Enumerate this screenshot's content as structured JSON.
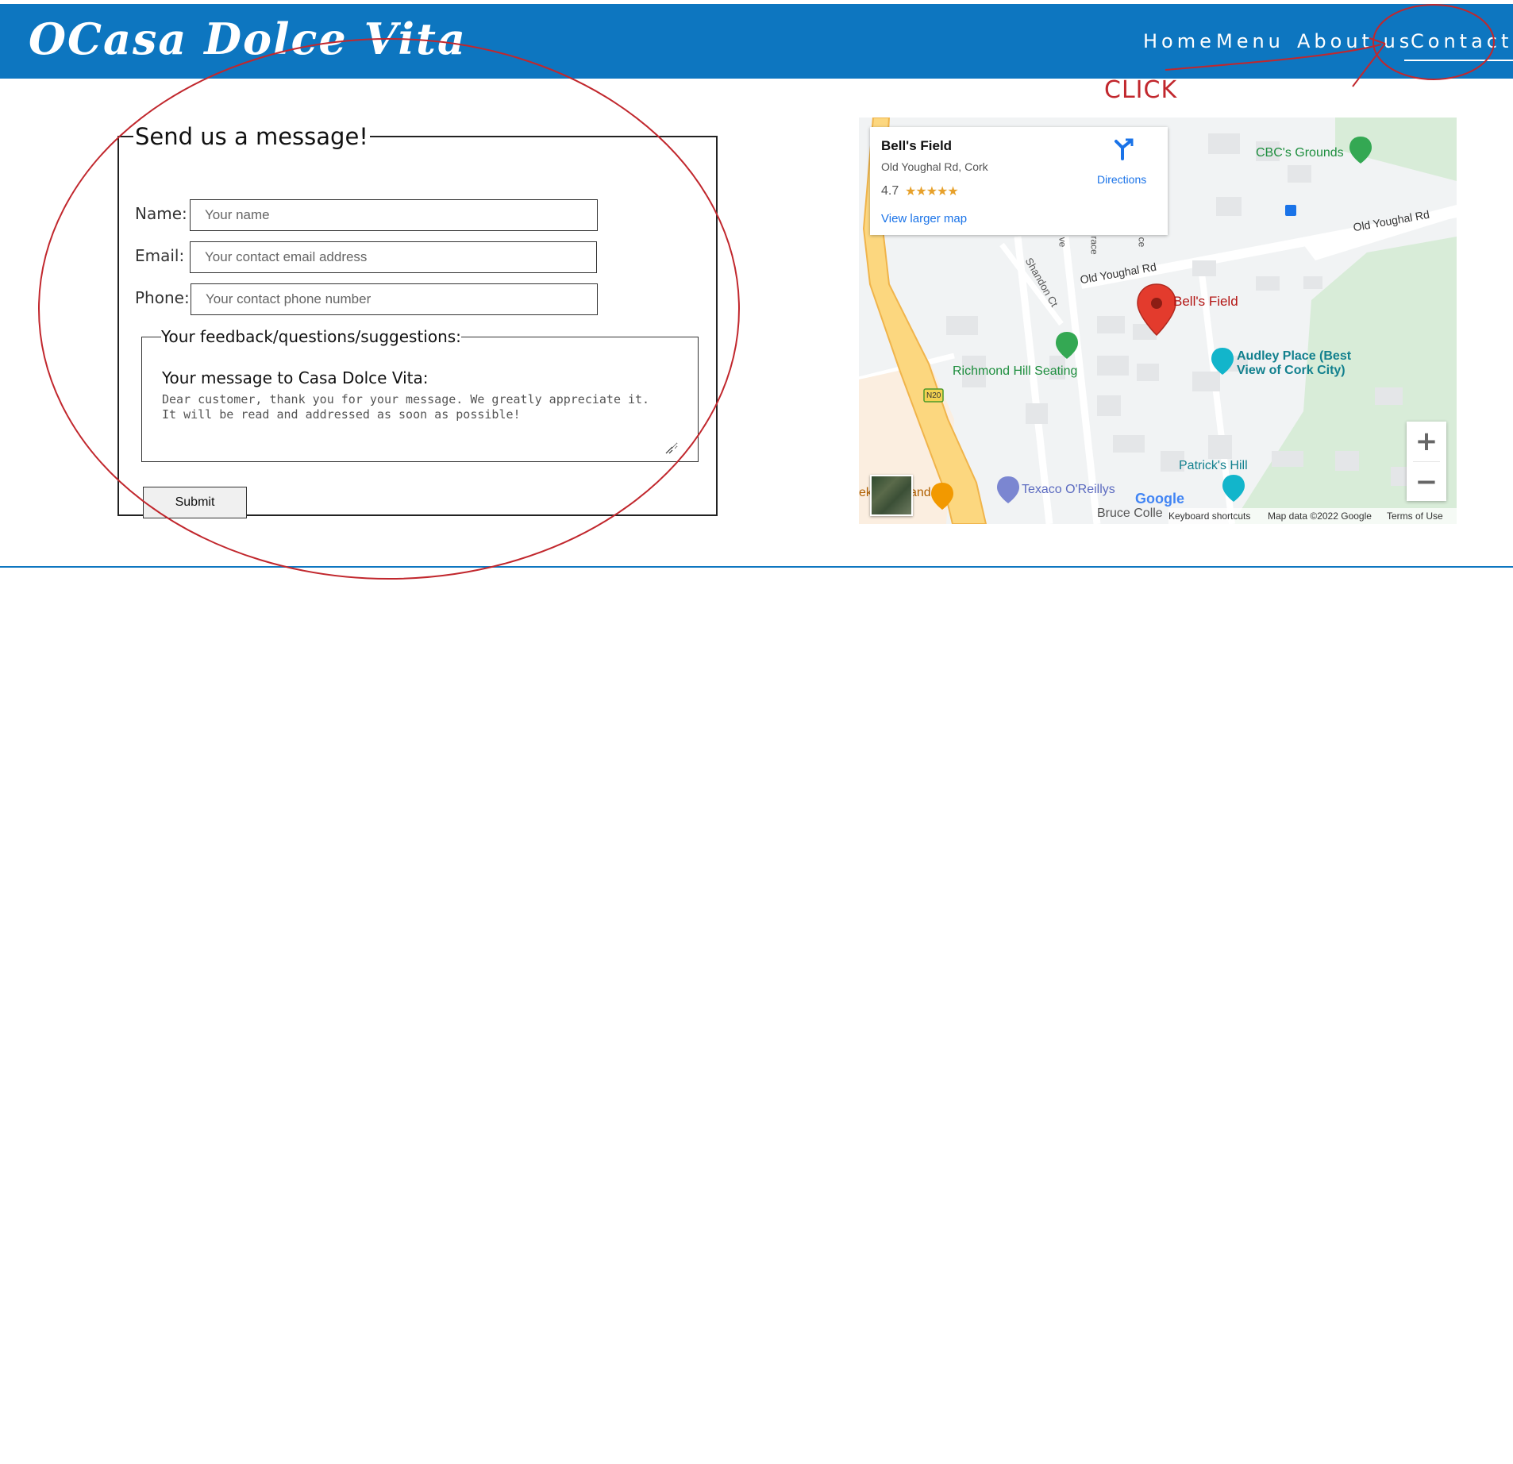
{
  "header": {
    "logo": "OCasa Dolce Vita",
    "nav": [
      {
        "label": "Home"
      },
      {
        "label": "Menu"
      },
      {
        "label": "About us"
      },
      {
        "label": "Contact"
      }
    ],
    "active_nav": "Contact",
    "brand_color": "#0d76c0"
  },
  "annotation": {
    "label": "CLICK",
    "color": "#c1272d"
  },
  "form": {
    "legend": "Send us a message!",
    "name_label": "Name:",
    "name_placeholder": "Your name",
    "email_label": "Email:",
    "email_placeholder": "Your contact email address",
    "phone_label": "Phone:",
    "phone_placeholder": "Your contact phone number",
    "feedback_legend": "Your feedback/questions/suggestions:",
    "message_label": "Your message to Casa Dolce Vita:",
    "message_value": "Dear customer, thank you for your message. We greatly appreciate it.\nIt will be read and addressed as soon as possible!",
    "submit_label": "Submit"
  },
  "map": {
    "place_name": "Bell's Field",
    "place_address": "Old Youghal Rd, Cork",
    "rating": "4.7",
    "stars": "★★★★★",
    "view_larger": "View larger map",
    "directions": "Directions",
    "labels": {
      "cbc": "CBC's Grounds",
      "old_youghal_1": "Old Youghal Rd",
      "old_youghal_2": "Old Youghal Rd",
      "bells_field": "Bell's Field",
      "richmond": "Richmond Hill Seating",
      "audley_1": "Audley Place (Best",
      "audley_2": "View of Cork City)",
      "shandon": "Shandon Ct",
      "patricks": "Patrick's Hill",
      "texaco": "Texaco O'Reillys",
      "bruce": "Bruce Colle",
      "n20": "N20",
      "ek": "ek",
      "and": "and",
      "ve": "ve",
      "race": "race",
      "ce": "ce"
    },
    "zoom_in": "+",
    "zoom_out": "−",
    "google": "Google",
    "keyboard": "Keyboard shortcuts",
    "map_data": "Map data ©2022 Google",
    "terms": "Terms of Use"
  }
}
